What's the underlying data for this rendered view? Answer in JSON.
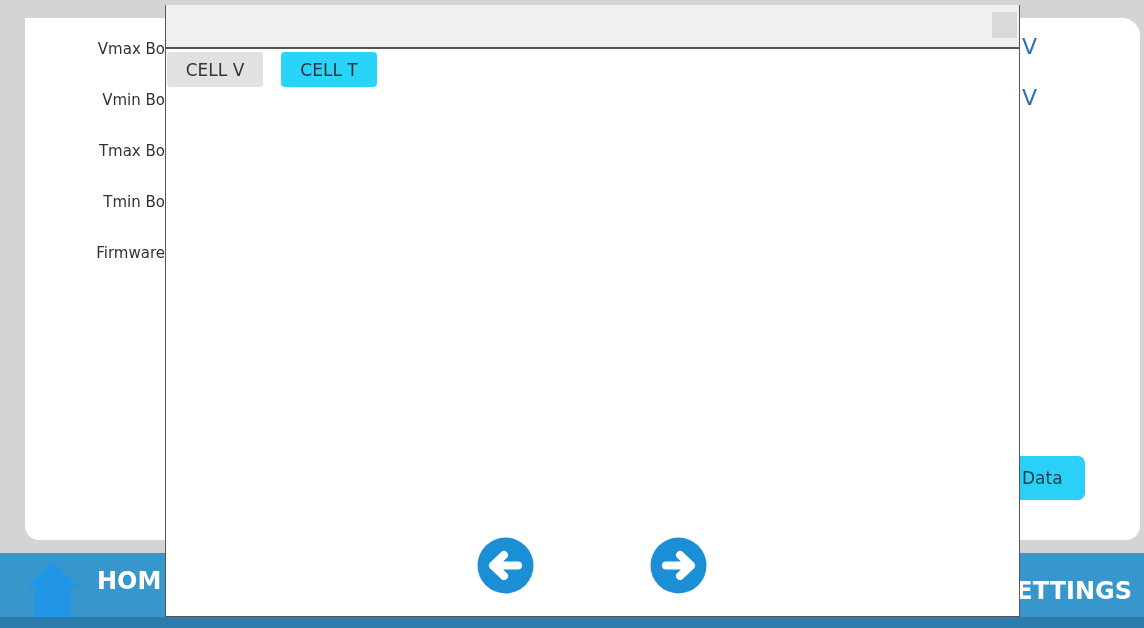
{
  "background": {
    "fields": [
      {
        "label": "Vmax Bo",
        "value": "V"
      },
      {
        "label": "Vmin Bo",
        "value": "V"
      },
      {
        "label": "Tmax Bo"
      },
      {
        "label": "Tmin Bo"
      },
      {
        "label": "Firmware"
      }
    ],
    "button": "Data"
  },
  "nav": [
    {
      "label": "HOM"
    },
    {
      "label": "ETTINGS"
    }
  ],
  "dialog": {
    "tabs": [
      {
        "label": "CELL V",
        "selected": false
      },
      {
        "label": "CELL T",
        "selected": true
      }
    ]
  }
}
